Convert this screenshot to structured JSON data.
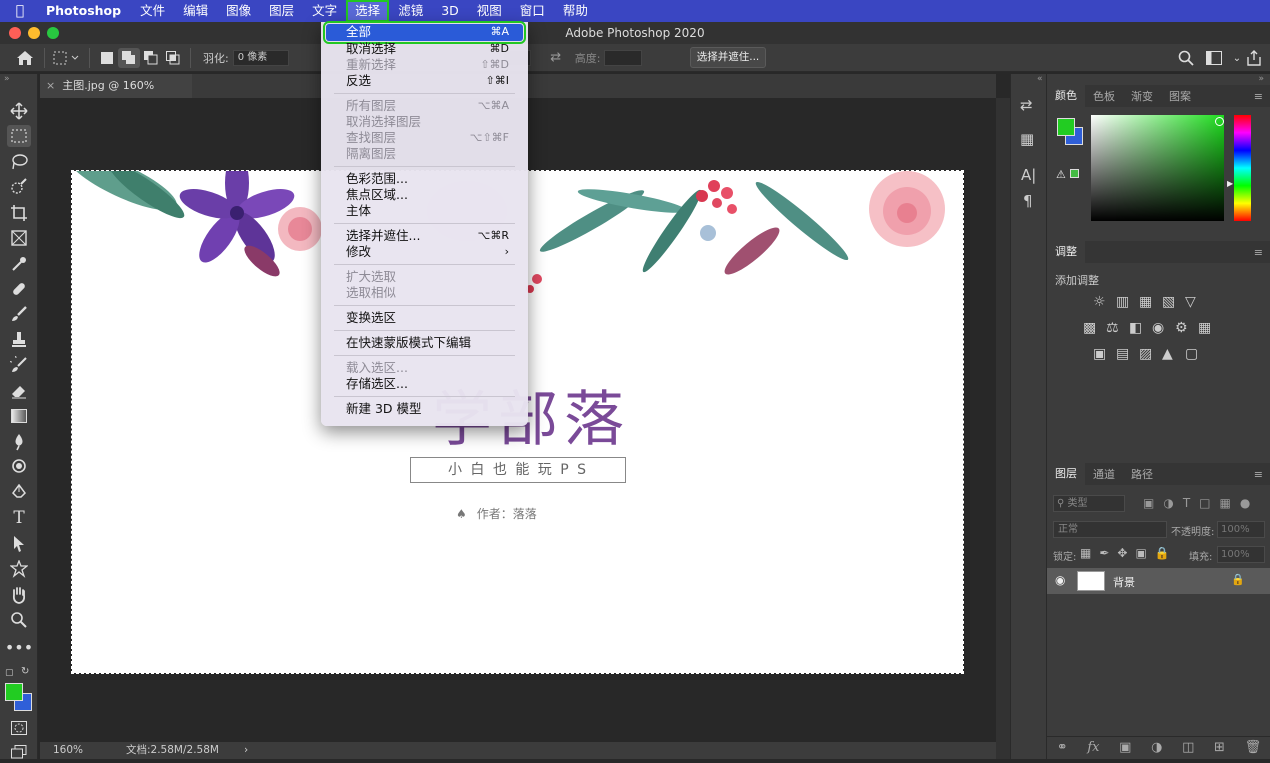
{
  "menubar": {
    "app_name": "Photoshop",
    "items": [
      "文件",
      "编辑",
      "图像",
      "图层",
      "文字",
      "选择",
      "滤镜",
      "3D",
      "视图",
      "窗口",
      "帮助"
    ],
    "active": "选择"
  },
  "window": {
    "title": "Adobe Photoshop 2020"
  },
  "options": {
    "feather_label": "羽化:",
    "feather_value": "0 像素",
    "height_label": "高度:",
    "select_mask_label": "选择并遮住..."
  },
  "document": {
    "tab_title": "主图.jpg @ 160%(RGB/8)",
    "heading_visible": "学部落",
    "subtitle": "小 白 也 能 玩 P S",
    "author": "作者：落落"
  },
  "status": {
    "zoom": "160%",
    "doc_info": "文档:2.58M/2.58M"
  },
  "select_menu": {
    "groups": [
      [
        {
          "label": "全部",
          "shortcut": "⌘A",
          "state": "highlighted"
        },
        {
          "label": "取消选择",
          "shortcut": "⌘D",
          "state": "enabled"
        },
        {
          "label": "重新选择",
          "shortcut": "⇧⌘D",
          "state": "disabled"
        },
        {
          "label": "反选",
          "shortcut": "⇧⌘I",
          "state": "enabled"
        }
      ],
      [
        {
          "label": "所有图层",
          "shortcut": "⌥⌘A",
          "state": "disabled"
        },
        {
          "label": "取消选择图层",
          "shortcut": "",
          "state": "disabled"
        },
        {
          "label": "查找图层",
          "shortcut": "⌥⇧⌘F",
          "state": "disabled"
        },
        {
          "label": "隔离图层",
          "shortcut": "",
          "state": "disabled"
        }
      ],
      [
        {
          "label": "色彩范围...",
          "shortcut": "",
          "state": "enabled"
        },
        {
          "label": "焦点区域...",
          "shortcut": "",
          "state": "enabled"
        },
        {
          "label": "主体",
          "shortcut": "",
          "state": "enabled"
        }
      ],
      [
        {
          "label": "选择并遮住...",
          "shortcut": "⌥⌘R",
          "state": "enabled"
        },
        {
          "label": "修改",
          "shortcut": "›",
          "state": "enabled"
        }
      ],
      [
        {
          "label": "扩大选取",
          "shortcut": "",
          "state": "disabled"
        },
        {
          "label": "选取相似",
          "shortcut": "",
          "state": "disabled"
        }
      ],
      [
        {
          "label": "变换选区",
          "shortcut": "",
          "state": "enabled"
        }
      ],
      [
        {
          "label": "在快速蒙版模式下编辑",
          "shortcut": "",
          "state": "enabled"
        }
      ],
      [
        {
          "label": "载入选区...",
          "shortcut": "",
          "state": "disabled"
        },
        {
          "label": "存储选区...",
          "shortcut": "",
          "state": "enabled"
        }
      ],
      [
        {
          "label": "新建 3D 模型",
          "shortcut": "",
          "state": "enabled"
        }
      ]
    ]
  },
  "panels": {
    "color_tabs": [
      "颜色",
      "色板",
      "渐变",
      "图案"
    ],
    "adjust_title": "调整",
    "adjust_add": "添加调整",
    "layer_tabs": [
      "图层",
      "通道",
      "路径"
    ],
    "layer_filter": "类型",
    "blend_mode": "正常",
    "opacity_label": "不透明度:",
    "opacity_value": "100%",
    "lock_label": "锁定:",
    "fill_label": "填充:",
    "fill_value": "100%",
    "layer_name": "背景"
  },
  "colors": {
    "foreground": "#22cc22",
    "background": "#2f5fd8",
    "menu_accent": "#2a5bd8",
    "highlight_outline": "#22c722",
    "title_purple": "#7a4a98"
  }
}
